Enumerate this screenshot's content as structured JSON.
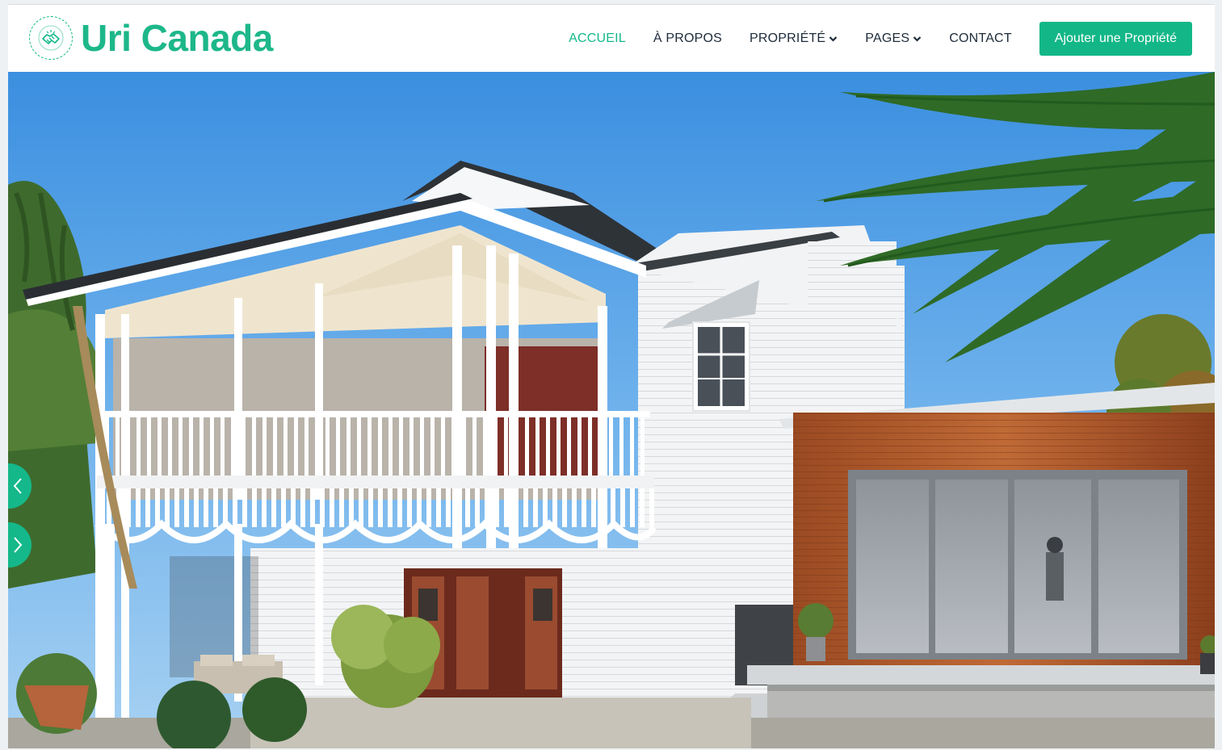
{
  "brand": {
    "name": "Uri Canada",
    "accent_color": "#14b88a",
    "logo_icon": "handshake-icon"
  },
  "nav": {
    "items": [
      {
        "label": "ACCUEIL",
        "active": true
      },
      {
        "label": "À PROPOS",
        "active": false
      },
      {
        "label": "PROPRIÉTÉ",
        "active": false,
        "dropdown": true
      },
      {
        "label": "PAGES",
        "active": false,
        "dropdown": true
      },
      {
        "label": "CONTACT",
        "active": false
      }
    ],
    "cta_label": "Ajouter une Propriété"
  },
  "hero": {
    "image_subject": "white two-storey house with veranda and timber-clad extension",
    "prev_icon": "chevron-left-icon",
    "next_icon": "chevron-right-icon"
  }
}
